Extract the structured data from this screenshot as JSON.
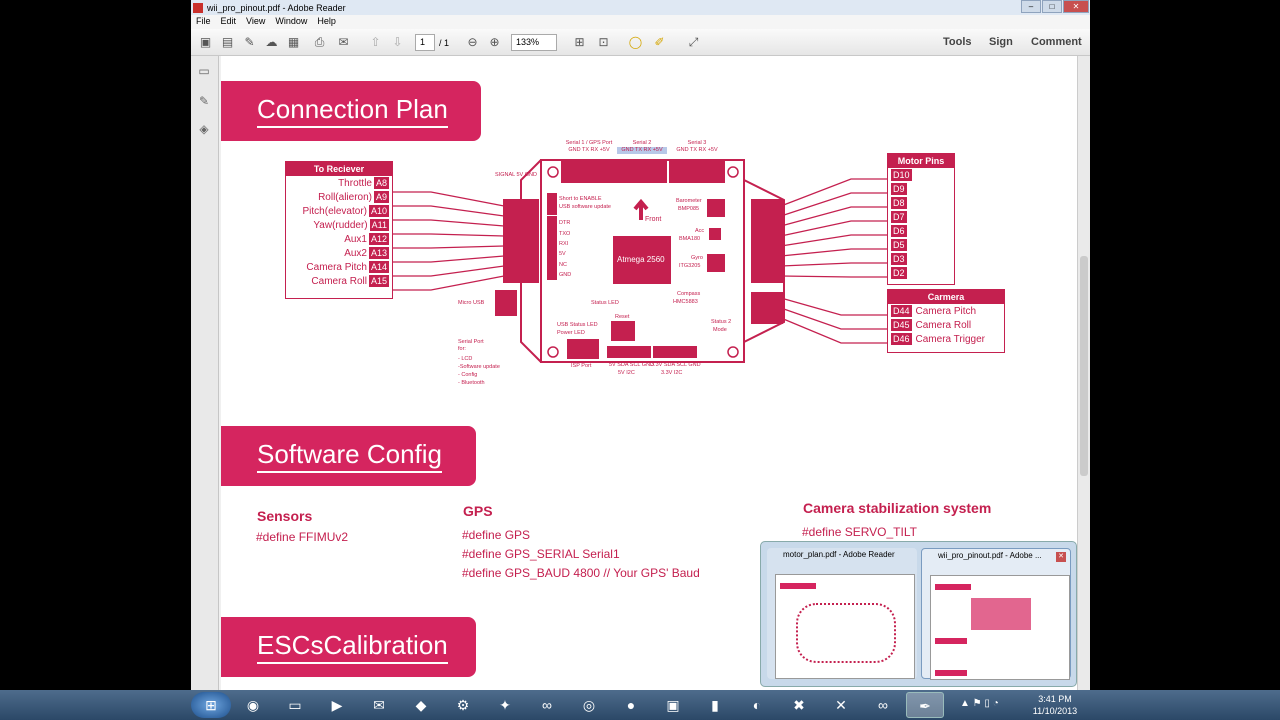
{
  "window": {
    "title": "wii_pro_pinout.pdf - Adobe Reader"
  },
  "menu": [
    "File",
    "Edit",
    "View",
    "Window",
    "Help"
  ],
  "toolbar": {
    "page_current": "1",
    "page_total": "/ 1",
    "zoom": "133%",
    "tools": "Tools",
    "sign": "Sign",
    "comment": "Comment"
  },
  "doc": {
    "banner1": "Connection Plan",
    "banner2": "Software Config",
    "banner3": "ESCsCalibration",
    "receiver": {
      "title": "To Reciever",
      "rows": [
        {
          "label": "Throttle",
          "pin": "A8"
        },
        {
          "label": "Roll(alieron)",
          "pin": "A9"
        },
        {
          "label": "Pitch(elevator)",
          "pin": "A10"
        },
        {
          "label": "Yaw(rudder)",
          "pin": "A11"
        },
        {
          "label": "Aux1",
          "pin": "A12"
        },
        {
          "label": "Aux2",
          "pin": "A13"
        },
        {
          "label": "Camera Pitch",
          "pin": "A14"
        },
        {
          "label": "Camera Roll",
          "pin": "A15"
        }
      ]
    },
    "motor": {
      "title": "Motor Pins",
      "pins": [
        "D10",
        "D9",
        "D8",
        "D7",
        "D6",
        "D5",
        "D3",
        "D2"
      ]
    },
    "camera": {
      "title": "Carmera",
      "rows": [
        {
          "pin": "D44",
          "label": "Camera Pitch"
        },
        {
          "pin": "D45",
          "label": "Camera Roll"
        },
        {
          "pin": "D46",
          "label": "Camera Trigger"
        }
      ]
    },
    "board": {
      "serial1": "Serial 1 / GPS Port",
      "serial1_pins": "GND TX RX +5V",
      "serial2": "Serial 2",
      "serial2_pins": "GND TX RX +5V",
      "serial3": "Serial 3",
      "serial3_pins": "GND TX RX +5V",
      "sig": "SIGNAL 5V GND",
      "short": "Short to ENABLE",
      "usb_update": "USB software update",
      "front": "Front",
      "dtr": "DTR",
      "txo": "TXO",
      "rxi": "RXI",
      "v5": "5V",
      "nc": "NC",
      "gnd": "GND",
      "chip": "Atmega 2560",
      "baro": "Barometer",
      "baro2": "BMP085",
      "acc": "Acc",
      "acc2": "BMA180",
      "gyro": "Gyro",
      "gyro2": "ITG3205",
      "compass": "Compass",
      "compass2": "HMC5883",
      "status_led": "Status LED",
      "reset": "Reset",
      "usb_led": "USB Status LED",
      "power_led": "Power LED",
      "status2": "Status 2",
      "mode": "Mode",
      "microusb": "Micro USB",
      "serialport": "Serial Port for:",
      "sp1": "- LCD",
      "sp2": "-Software update",
      "sp3": "- Config",
      "sp4": "- Bluetooth",
      "isp": "ISP Port",
      "i2c1": "5V SDA SCL GND",
      "i2c1b": "5V I2C",
      "i2c2": "3.3V SDA SCL GND",
      "i2c2b": "3.3V I2C"
    },
    "sensors_h": "Sensors",
    "sensors_code": "#define FFIMUv2",
    "gps_h": "GPS",
    "gps_code": [
      "#define GPS",
      "#define GPS_SERIAL Serial1",
      "#define GPS_BAUD   4800 // Your GPS' Baud"
    ],
    "cam_h": "Camera stabilization system",
    "cam_code": "#define SERVO_TILT"
  },
  "popup": {
    "t1": "motor_plan.pdf - Adobe Reader",
    "t2": "wii_pro_pinout.pdf - Adobe ..."
  },
  "clock": {
    "time": "3:41 PM",
    "date": "11/10/2013"
  },
  "colors": {
    "accent": "#d5255f"
  }
}
